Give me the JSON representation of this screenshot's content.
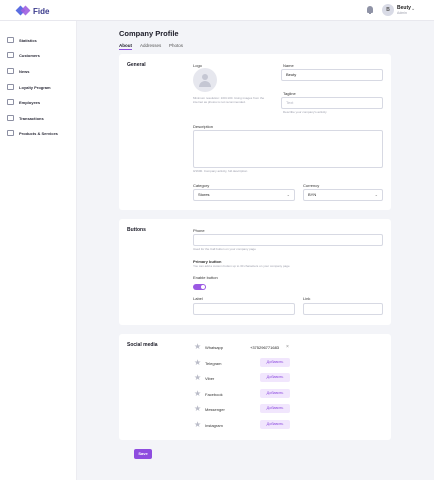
{
  "app": {
    "name": "Fide"
  },
  "user": {
    "name": "Beuty",
    "role": "Admin",
    "initial": "B"
  },
  "sidebar": {
    "items": [
      {
        "label": "Statistics",
        "icon": "chart-icon"
      },
      {
        "label": "Customers",
        "icon": "users-icon"
      },
      {
        "label": "News",
        "icon": "news-icon"
      },
      {
        "label": "Loyalty Program",
        "icon": "gift-icon"
      },
      {
        "label": "Employees",
        "icon": "employees-icon"
      },
      {
        "label": "Transactions",
        "icon": "transactions-icon"
      },
      {
        "label": "Products & Services",
        "icon": "cart-icon"
      }
    ]
  },
  "page": {
    "title": "Company Profile",
    "tabs": [
      "About",
      "Addresses",
      "Photos"
    ],
    "active_tab": "About"
  },
  "general": {
    "title": "General",
    "logo_label": "Logo",
    "logo_hint": "Minimum resolution: 100×100. Using images from the internet as photos is not recommended.",
    "name_label": "Name",
    "name_value": "Beuty",
    "tagline_label": "Tagline",
    "tagline_placeholder": "Text",
    "tagline_hint": "Describe your company's activity",
    "description_label": "Description",
    "description_hint": "0/1600. Company activity, full description",
    "category_label": "Category",
    "category_value": "Stores",
    "currency_label": "Currency",
    "currency_value": "BYN"
  },
  "buttons": {
    "title": "Buttons",
    "phone_label": "Phone",
    "phone_hint": "Used for the Call button on your company page",
    "primary_title": "Primary button",
    "primary_hint": "You can add a custom button up to 30 characters on your company page",
    "enable_label": "Enable button",
    "enabled": true,
    "label_label": "Label",
    "link_label": "Link"
  },
  "social": {
    "title": "Social media",
    "items": [
      {
        "name": "Whatsapp",
        "value": "+375296771683",
        "action": ""
      },
      {
        "name": "Telegram",
        "value": "",
        "action": "Добавить"
      },
      {
        "name": "Viber",
        "value": "",
        "action": "Добавить"
      },
      {
        "name": "Facebook",
        "value": "",
        "action": "Добавить"
      },
      {
        "name": "Messenger",
        "value": "",
        "action": "Добавить"
      },
      {
        "name": "Instagram",
        "value": "",
        "action": "Добавить"
      }
    ]
  },
  "footer": {
    "save_label": "Save"
  },
  "colors": {
    "accent": "#8e4ddf",
    "accent_light": "#f1e6fd",
    "background": "#f3f4f8"
  }
}
